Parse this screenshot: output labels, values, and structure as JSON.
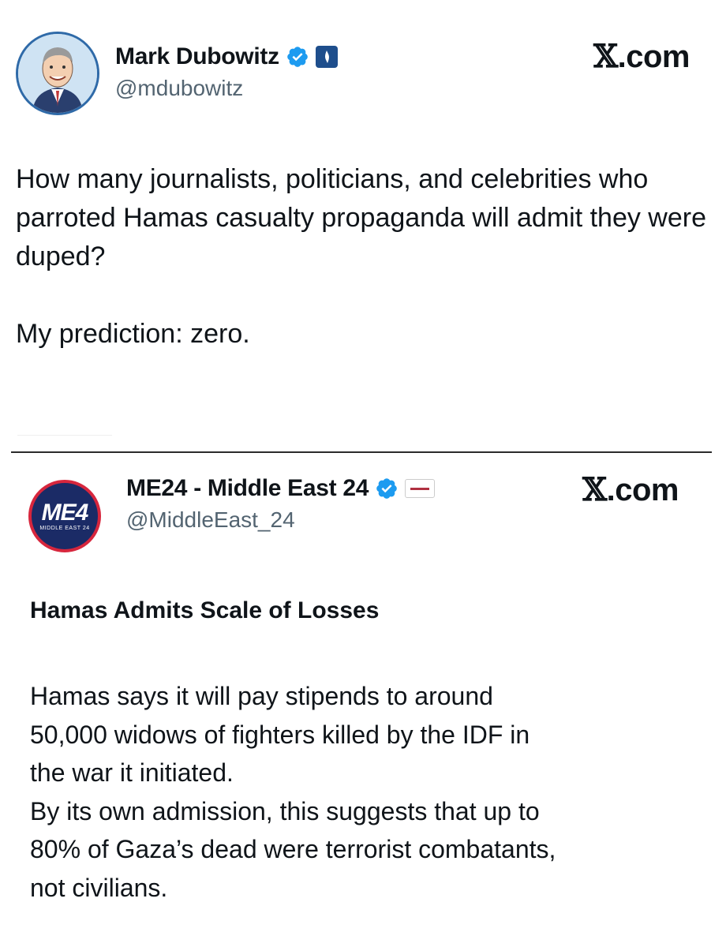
{
  "main_tweet": {
    "author_name": "Mark Dubowitz",
    "handle": "@mdubowitz",
    "site_label": "X.com",
    "text": "How many journalists, politicians, and celebrities who parroted Hamas casualty propaganda will admit they were duped?\n\nMy prediction: zero.",
    "icons": [
      "avatar-caricature",
      "verified-badge-icon",
      "affiliate-badge-icon"
    ]
  },
  "quoted_tweet": {
    "author_name": "ME24 - Middle East 24",
    "handle": "@MiddleEast_24",
    "site_label": "X.com",
    "avatar_logo": "ME4",
    "avatar_subtitle": "MIDDLE EAST 24",
    "headline": "Hamas Admits Scale of Losses",
    "body_lines": [
      "Hamas says it will pay stipends to around",
      "50,000 widows of fighters killed by the IDF in",
      "the war it initiated.",
      "By its own admission, this suggests that up to",
      "80% of Gaza’s dead were terrorist combatants,",
      "not civilians."
    ]
  },
  "colors": {
    "text": "#0f1419",
    "secondary_text": "#536471",
    "verified_blue": "#1d9bf0",
    "affiliate_blue": "#1e4e8c",
    "me24_navy": "#1b2b66",
    "me24_red": "#d7263d"
  }
}
